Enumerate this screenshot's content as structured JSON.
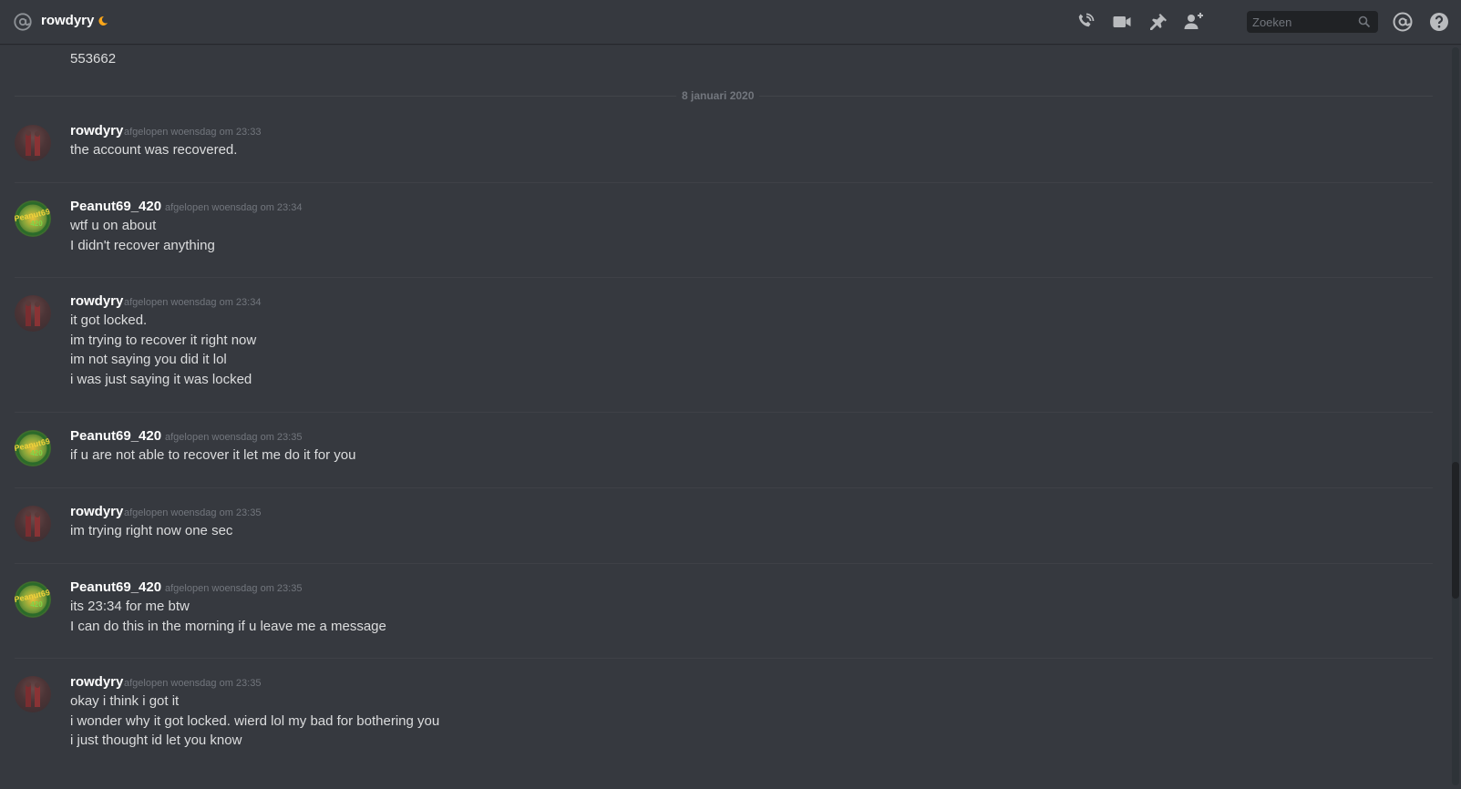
{
  "header": {
    "channel_name": "rowdyry",
    "status_icon": "crescent-moon-icon",
    "search_placeholder": "Zoeken",
    "icons": [
      "phone-call-icon",
      "video-camera-icon",
      "pin-icon",
      "add-friend-icon",
      "search-icon",
      "mentions-at-icon",
      "help-icon"
    ]
  },
  "colors": {
    "background": "#36393f",
    "username": "#ffffff",
    "message_text": "#dcddde",
    "muted": "#72767d",
    "idle_status": "#faa61a"
  },
  "previous_message_tail": "553662",
  "date_divider": "8 januari 2020",
  "messages": [
    {
      "author": "rowdyry",
      "timestamp": "afgelopen woensdag om 23:33",
      "lines": [
        "the account was recovered."
      ]
    },
    {
      "author": "Peanut69_420",
      "timestamp": "afgelopen woensdag om 23:34",
      "lines": [
        "wtf u on about",
        "I didn't recover anything"
      ]
    },
    {
      "author": "rowdyry",
      "timestamp": "afgelopen woensdag om 23:34",
      "lines": [
        "it got locked.",
        "im trying to recover it right now",
        "im not saying you did it lol",
        "i was just saying it was locked"
      ]
    },
    {
      "author": "Peanut69_420",
      "timestamp": "afgelopen woensdag om 23:35",
      "lines": [
        "if u are not able to recover it let me do it for you"
      ]
    },
    {
      "author": "rowdyry",
      "timestamp": "afgelopen woensdag om 23:35",
      "lines": [
        "im trying right now one sec"
      ]
    },
    {
      "author": "Peanut69_420",
      "timestamp": "afgelopen woensdag om 23:35",
      "lines": [
        "its 23:34 for me btw",
        "I can do this in the morning if u leave me a message"
      ]
    },
    {
      "author": "rowdyry",
      "timestamp": "afgelopen woensdag om 23:35",
      "lines": [
        "okay i think i got it",
        "i wonder why it got locked. wierd lol my bad for bothering you",
        "i just thought id let you know"
      ]
    }
  ]
}
